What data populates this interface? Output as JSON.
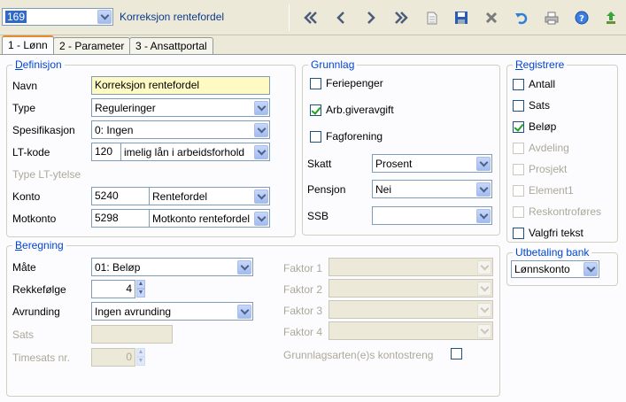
{
  "toolbar": {
    "record_id": "169",
    "record_name": "Korreksjon rentefordel",
    "icons": [
      "first-icon",
      "prev-icon",
      "next-icon",
      "last-icon",
      "new-icon",
      "save-icon",
      "delete-icon",
      "undo-icon",
      "print-icon",
      "help-icon",
      "export-icon"
    ]
  },
  "tabs": [
    {
      "label": "1 - Lønn"
    },
    {
      "label": "2 - Parameter"
    },
    {
      "label": "3 - Ansattportal"
    }
  ],
  "definisjon": {
    "legend_first": "D",
    "legend_rest": "efinisjon",
    "navn_label": "Navn",
    "navn_value": "Korreksjon rentefordel",
    "type_label": "Type",
    "type_value": "Reguleringer",
    "spes_label": "Spesifikasjon",
    "spes_value": "0: Ingen",
    "ltkode_label": "LT-kode",
    "ltkode_code": "120",
    "ltkode_value": "imelig lån i arbeidsforhold",
    "type_lt_label": "Type LT-ytelse",
    "konto_label": "Konto",
    "konto_code": "5240",
    "konto_value": "Rentefordel",
    "motkonto_label": "Motkonto",
    "motkonto_code": "5298",
    "motkonto_value": "Motkonto rentefordel"
  },
  "grunnlag": {
    "legend": "Grunnlag",
    "feriepenger": "Feriepenger",
    "arbgiver": "Arb.giveravgift",
    "fagforening": "Fagforening",
    "skatt_label": "Skatt",
    "skatt_value": "Prosent",
    "pensjon_label": "Pensjon",
    "pensjon_value": "Nei",
    "ssb_label": "SSB",
    "ssb_value": ""
  },
  "registrere": {
    "legend_first": "R",
    "legend_rest": "egistrere",
    "items": [
      {
        "label": "Antall"
      },
      {
        "label": "Sats"
      },
      {
        "label": "Beløp"
      },
      {
        "label": "Avdeling"
      },
      {
        "label": "Prosjekt"
      },
      {
        "label": "Element1"
      },
      {
        "label": "Reskontroføres"
      },
      {
        "label": "Valgfri tekst"
      }
    ]
  },
  "utbetaling": {
    "legend": "Utbetaling bank",
    "value": "Lønnskonto"
  },
  "beregning": {
    "legend_first": "B",
    "legend_rest": "eregning",
    "mate_label": "Måte",
    "mate_value": "01: Beløp",
    "rekke_label": "Rekkefølge",
    "rekke_value": "4",
    "avrunding_label": "Avrunding",
    "avrunding_value": "Ingen avrunding",
    "sats_label": "Sats",
    "timesats_label": "Timesats nr.",
    "timesats_value": "0",
    "faktor1": "Faktor 1",
    "faktor2": "Faktor 2",
    "faktor3": "Faktor 3",
    "faktor4": "Faktor 4",
    "grunnlagsart": "Grunnlagsarten(e)s kontostreng"
  },
  "colors": {
    "accent": "#316ac5",
    "legend": "#0046d5",
    "highlight_field": "#fff9c4"
  }
}
